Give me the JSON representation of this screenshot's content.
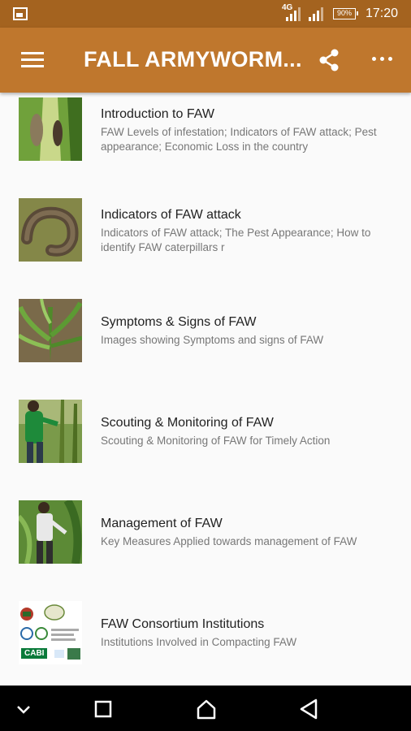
{
  "status_bar": {
    "network": "4G",
    "battery": "90%",
    "time": "17:20"
  },
  "app_bar": {
    "title": "FALL ARMYWORM..."
  },
  "items": [
    {
      "title": "Introduction to FAW",
      "subtitle": "FAW Levels of infestation; Indicators of FAW attack; Pest appearance; Economic Loss in the country"
    },
    {
      "title": "Indicators of FAW attack",
      "subtitle": "Indicators of FAW attack; The Pest Appearance; How to identify FAW caterpillars r"
    },
    {
      "title": "Symptoms & Signs of FAW",
      "subtitle": "Images showing Symptoms and signs of FAW"
    },
    {
      "title": "Scouting & Monitoring of FAW",
      "subtitle": "Scouting & Monitoring of FAW for Timely Action"
    },
    {
      "title": "Management of FAW",
      "subtitle": "Key Measures Applied towards management of FAW"
    },
    {
      "title": "FAW Consortium Institutions",
      "subtitle": "Institutions Involved in Compacting FAW"
    }
  ],
  "institution_logo": {
    "label": "CABI"
  },
  "colors": {
    "status_bar": "#a4631f",
    "app_bar": "#bf772d",
    "nav_bar": "#000000"
  }
}
